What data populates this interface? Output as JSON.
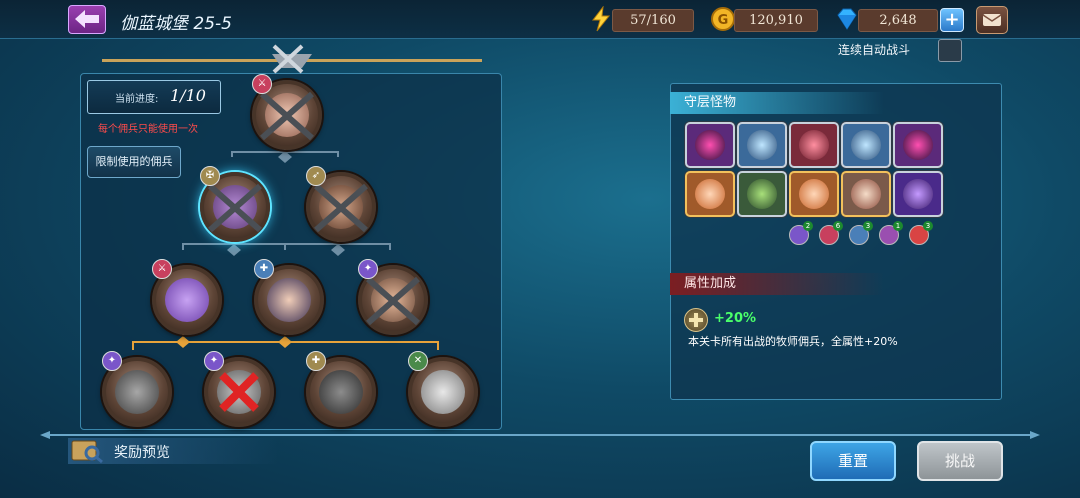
{
  "header": {
    "stage_title": "伽蓝城堡 25-5",
    "stamina": "57/160",
    "gold": "120,910",
    "gems": "2,648"
  },
  "auto_battle": {
    "label": "连续自动战斗",
    "checked": false
  },
  "left_panel": {
    "progress_label": "当前进度:",
    "progress_value": "1/10",
    "warning": "每个佣兵只能使用一次",
    "limit_button": "限制使用的佣兵",
    "nodes": [
      {
        "tier": 1,
        "class": "berserker",
        "state": "defeated"
      },
      {
        "tier": 2,
        "class": "sword",
        "state": "defeated-selected"
      },
      {
        "tier": 2,
        "class": "archer",
        "state": "defeated"
      },
      {
        "tier": 3,
        "class": "berserker",
        "state": "available"
      },
      {
        "tier": 3,
        "class": "priest",
        "state": "available"
      },
      {
        "tier": 3,
        "class": "mage",
        "state": "defeated"
      },
      {
        "tier": 4,
        "class": "mage",
        "state": "available"
      },
      {
        "tier": 4,
        "class": "mage",
        "state": "blocked"
      },
      {
        "tier": 4,
        "class": "priest",
        "state": "available"
      },
      {
        "tier": 4,
        "class": "sword",
        "state": "available"
      }
    ]
  },
  "guard_monsters": {
    "title": "守层怪物",
    "row1": [
      "purple-demon",
      "ice-dragon",
      "red-dragon",
      "ice-dragon",
      "purple-demon"
    ],
    "row2": [
      "fox-girl",
      "cat-beast",
      "fox-girl",
      "pirate-captain",
      "purple-dragon"
    ],
    "class_counts": [
      {
        "class": "mage",
        "count": "2",
        "color": "#7a56c9"
      },
      {
        "class": "berserker",
        "count": "6",
        "color": "#c8405e"
      },
      {
        "class": "knight",
        "count": "3",
        "color": "#4a7fb8"
      },
      {
        "class": "demon",
        "count": "1",
        "color": "#9a4fb0"
      },
      {
        "class": "assassin",
        "count": "3",
        "color": "#d94444"
      }
    ]
  },
  "attribute_bonus": {
    "title": "属性加成",
    "value": "+20%",
    "description": "本关卡所有出战的牧师佣兵，全属性+20%"
  },
  "footer": {
    "reward_preview": "奖励预览",
    "reset": "重置",
    "challenge": "挑战"
  },
  "colors": {
    "accent_blue": "#3bb1d6",
    "bonus_green": "#4aff6a",
    "warning_red": "#ff4b4b"
  }
}
